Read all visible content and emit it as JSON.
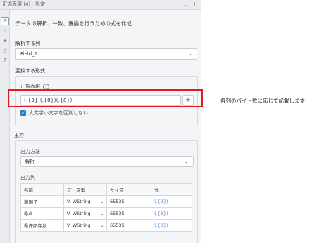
{
  "titlebar": {
    "title": "正規表現 (4) - 設定"
  },
  "sidebar": {
    "icons": [
      "settings-icon",
      "code-icon",
      "network-icon",
      "tag-icon",
      "help-icon"
    ]
  },
  "description": "データの解析、一致、置換を行うための式を作成",
  "parse_column": {
    "label": "解析する列",
    "value": "Field_1"
  },
  "format": {
    "label": "変換する形式",
    "regex_label": "正規表現",
    "regex_value": "(.{3})(.{8})(.{8})",
    "case_label": "大文字小文字を区別しない",
    "case_checked": true
  },
  "output": {
    "label": "出力",
    "method_label": "出力方法",
    "method_value": "解析",
    "columns_label": "出力列",
    "headers": [
      "名前",
      "データ型",
      "サイズ",
      "式"
    ],
    "rows": [
      {
        "name": "識別子",
        "type": "V_WString",
        "size": "65535",
        "expr": "(.{3})"
      },
      {
        "name": "県名",
        "type": "V_WString",
        "size": "65535",
        "expr": "(.{8})"
      },
      {
        "name": "県庁所在地",
        "type": "V_WString",
        "size": "65535",
        "expr": "(.{8})"
      }
    ]
  },
  "annotation": {
    "text": "各列のバイト数に応じて記載します",
    "color": "#e11b22"
  }
}
